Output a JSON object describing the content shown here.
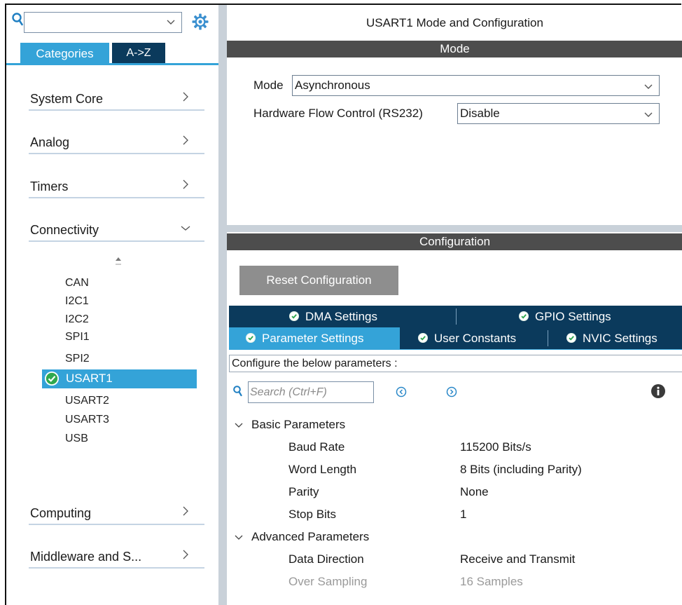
{
  "left_panel": {
    "search": {
      "value": ""
    },
    "tabs": {
      "categories": "Categories",
      "az": "A->Z"
    },
    "categories": [
      {
        "label": "System Core",
        "expanded": false
      },
      {
        "label": "Analog",
        "expanded": false
      },
      {
        "label": "Timers",
        "expanded": false
      },
      {
        "label": "Connectivity",
        "expanded": true
      },
      {
        "label": "Computing",
        "expanded": false
      },
      {
        "label": "Middleware and S...",
        "expanded": false
      }
    ],
    "connectivity_items": [
      "CAN",
      "I2C1",
      "I2C2",
      "SPI1",
      "SPI2",
      "USART1",
      "USART2",
      "USART3",
      "USB"
    ],
    "selected_item": "USART1"
  },
  "right_panel": {
    "title": "USART1 Mode and Configuration",
    "mode_header": "Mode",
    "mode": {
      "mode_label": "Mode",
      "mode_value": "Asynchronous",
      "flow_label": "Hardware Flow Control (RS232)",
      "flow_value": "Disable"
    },
    "config_header": "Configuration",
    "reset_button": "Reset Configuration",
    "tabs_row1": [
      "DMA Settings",
      "GPIO Settings"
    ],
    "tabs_row2": [
      "Parameter Settings",
      "User Constants",
      "NVIC Settings"
    ],
    "selected_tab": "Parameter Settings",
    "prompt": "Configure the below parameters :",
    "search_placeholder": "Search (Ctrl+F)",
    "groups": [
      {
        "name": "Basic Parameters",
        "params": [
          {
            "name": "Baud Rate",
            "value": "115200 Bits/s"
          },
          {
            "name": "Word Length",
            "value": "8 Bits (including Parity)"
          },
          {
            "name": "Parity",
            "value": "None"
          },
          {
            "name": "Stop Bits",
            "value": "1"
          }
        ]
      },
      {
        "name": "Advanced Parameters",
        "params": [
          {
            "name": "Data Direction",
            "value": "Receive and Transmit"
          },
          {
            "name": "Over Sampling",
            "value": "16 Samples",
            "disabled": true
          }
        ]
      }
    ]
  },
  "colors": {
    "accent_blue": "#34a3d8",
    "navy": "#0b3a5c",
    "header_gray": "#4d4d4d",
    "button_gray": "#8e8e8e",
    "splitter": "#c9d1d9"
  },
  "icons": {
    "search": "magnifier-icon",
    "settings": "gear-icon",
    "tab_status": "check-circle-icon",
    "info": "info-icon",
    "prev": "chevron-left-circle-icon",
    "next": "chevron-right-circle-icon"
  }
}
